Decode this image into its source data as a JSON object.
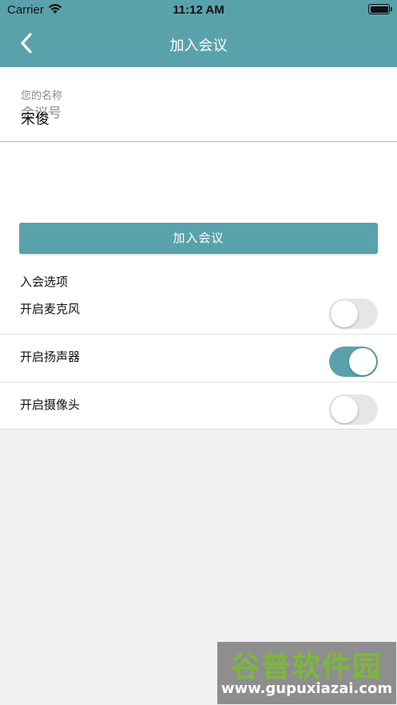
{
  "status_bar": {
    "carrier": "Carrier",
    "time": "11:12 AM"
  },
  "header": {
    "title": "加入会议",
    "back_icon": "chevron-left-icon"
  },
  "form": {
    "meeting_id": {
      "placeholder": "会议号",
      "value": ""
    },
    "name": {
      "label": "您的名称",
      "value": "宋俊"
    }
  },
  "join_button": {
    "label": "加入会议"
  },
  "options": {
    "title": "入会选项",
    "items": [
      {
        "label": "开启麦克风",
        "enabled": false
      },
      {
        "label": "开启扬声器",
        "enabled": true
      },
      {
        "label": "开启摄像头",
        "enabled": false
      }
    ]
  },
  "watermark": {
    "brand": "谷普软件园",
    "url": "www.gupuxiazai.com"
  },
  "colors": {
    "accent": "#5aa2ab",
    "background": "#f1f1f1"
  }
}
